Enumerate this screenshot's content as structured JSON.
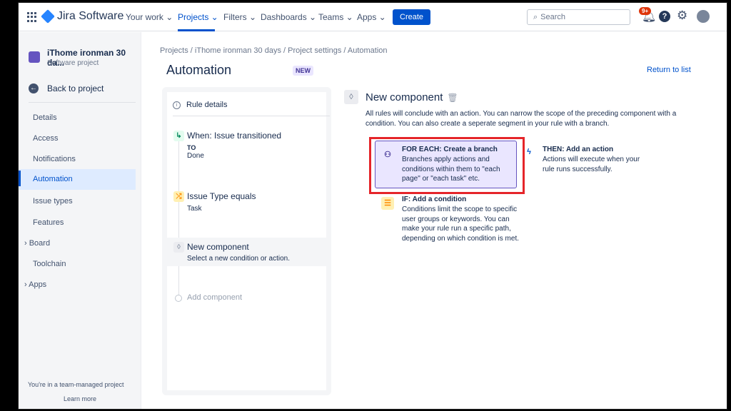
{
  "topnav": {
    "logo": "Jira Software",
    "items": [
      {
        "label": "Your work ⌄"
      },
      {
        "label": "Projects ⌄"
      },
      {
        "label": "Filters ⌄"
      },
      {
        "label": "Dashboards ⌄"
      },
      {
        "label": "Teams ⌄"
      },
      {
        "label": "Apps ⌄"
      }
    ],
    "create": "Create",
    "search_placeholder": "Search",
    "notif_badge": "9+"
  },
  "sidebar": {
    "project_name": "iThome ironman 30 da...",
    "project_type": "Software project",
    "back": "Back to project",
    "items": [
      {
        "label": "Details"
      },
      {
        "label": "Access"
      },
      {
        "label": "Notifications"
      },
      {
        "label": "Automation"
      },
      {
        "label": "Issue types"
      },
      {
        "label": "Features"
      },
      {
        "label": "›  Board"
      },
      {
        "label": "Toolchain"
      },
      {
        "label": "›  Apps"
      }
    ],
    "footer_text": "You're in a team-managed project",
    "footer_link": "Learn more"
  },
  "main": {
    "breadcrumb": "Projects  /  iThome ironman 30 days  /  Project settings  /  Automation",
    "title": "Automation",
    "new_badge": "NEW",
    "return_link": "Return to list"
  },
  "rule": {
    "details": "Rule details",
    "trigger_title": "When: Issue transitioned",
    "trigger_label": "TO",
    "trigger_value": "Done",
    "condition_title": "Issue Type equals",
    "condition_value": "Task",
    "new_comp_title": "New component",
    "new_comp_sub": "Select a new condition or action.",
    "add_component": "Add component"
  },
  "component": {
    "title": "New component",
    "description": "All rules will conclude with an action. You can narrow the scope of the preceding component with a condition. You can also create a seperate segment in your rule with a branch.",
    "foreach_title": "FOR EACH: Create a branch",
    "foreach_desc": "Branches apply actions and conditions within them to \"each page\" or \"each task\" etc.",
    "then_title": "THEN: Add an action",
    "then_desc": "Actions will execute when your rule runs successfully.",
    "if_title": "IF: Add a condition",
    "if_desc": "Conditions limit the scope to specific user groups or keywords. You can make your rule run a specific path, depending on which condition is met."
  },
  "colors": {
    "accent": "#0052CC",
    "highlight_box": "#E5252A",
    "branch_card": "#EAE6FF"
  }
}
